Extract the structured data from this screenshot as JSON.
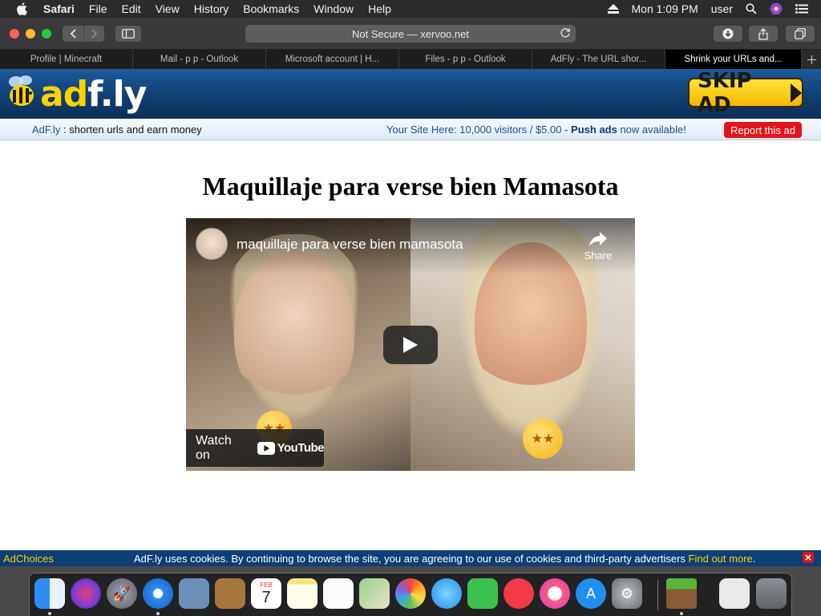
{
  "menubar": {
    "app": "Safari",
    "items": [
      "File",
      "Edit",
      "View",
      "History",
      "Bookmarks",
      "Window",
      "Help"
    ],
    "clock": "Mon 1:09 PM",
    "user": "user"
  },
  "toolbar": {
    "address": "Not Secure — xervoo.net"
  },
  "tabs": [
    {
      "label": "Profile | Minecraft"
    },
    {
      "label": "Mail - p p - Outlook"
    },
    {
      "label": "Microsoft account | H..."
    },
    {
      "label": "Files - p p - Outlook"
    },
    {
      "label": "AdFly - The URL shor..."
    },
    {
      "label": "Shrink your URLs and..."
    }
  ],
  "adfly": {
    "logo_ad": "ad",
    "logo_rest": "f.ly",
    "skip_label": "SKIP AD",
    "strip_brand": "AdF.ly",
    "strip_tagline": " : shorten urls and earn money",
    "promo_text": "Your Site Here: 10,000 visitors / $5.00 - ",
    "promo_bold": "Push ads",
    "promo_tail": " now available!",
    "report_label": "Report this ad"
  },
  "page": {
    "title": "Maquillaje para verse bien Mamasota"
  },
  "video": {
    "title": "maquillaje para verse bien mamasota",
    "share_label": "Share",
    "watch_on": "Watch on",
    "yt_label": "YouTube"
  },
  "cookie": {
    "adchoices": "AdChoices",
    "message": "AdF.ly uses cookies. By continuing to browse the site, you are agreeing to our use of cookies and third-party advertisers ",
    "find_out": "Find out more",
    "period": "."
  },
  "dock": {
    "calendar_month": "FEB",
    "calendar_day": "7"
  },
  "colors": {
    "adfly_blue": "#0f3d70",
    "skip_yellow": "#ffd200",
    "report_red": "#e1141a"
  }
}
